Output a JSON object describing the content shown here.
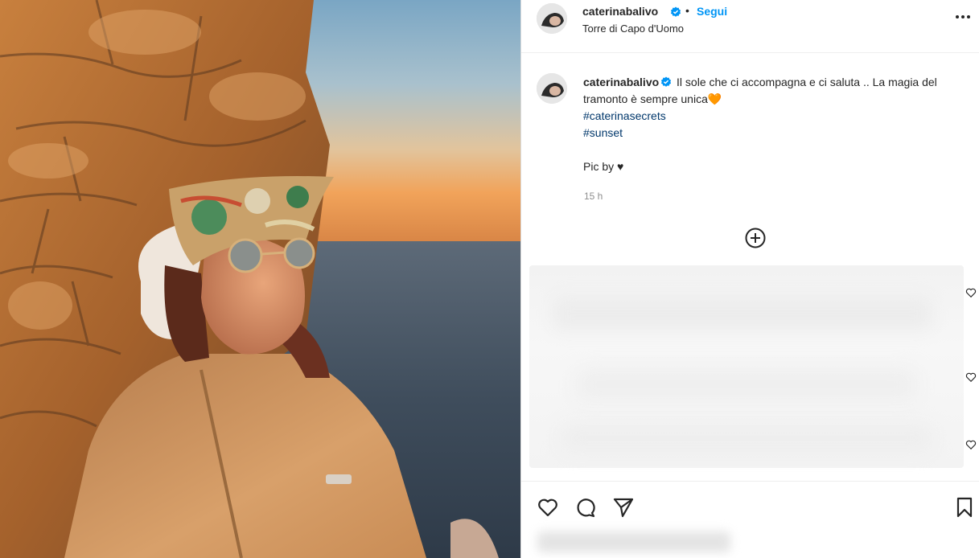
{
  "post": {
    "username": "caterinabalivo",
    "follow_label": "Segui",
    "separator": "•",
    "location": "Torre di Capo d'Uomo",
    "more_icon": "more-horizontal-icon",
    "verified_icon": "verified-badge-icon"
  },
  "caption": {
    "username": "caterinabalivo",
    "text": "Il sole che ci accompagna e ci saluta .. La magia del tramonto è sempre unica",
    "emoji": "🧡",
    "hashtags": [
      "#caterinasecrets",
      "#sunset"
    ],
    "pic_by": "Pic by ♥",
    "timestamp": "15 h"
  },
  "comments": {
    "add_icon": "plus-circle-icon",
    "like_icon": "heart-outline-icon"
  },
  "actions": {
    "like_icon": "heart-outline-icon",
    "comment_icon": "comment-icon",
    "share_icon": "send-icon",
    "save_icon": "bookmark-icon"
  },
  "colors": {
    "link": "#0095f6",
    "hashtag": "#00376b",
    "verified": "#0095f6",
    "muted": "#8e8e8e"
  }
}
